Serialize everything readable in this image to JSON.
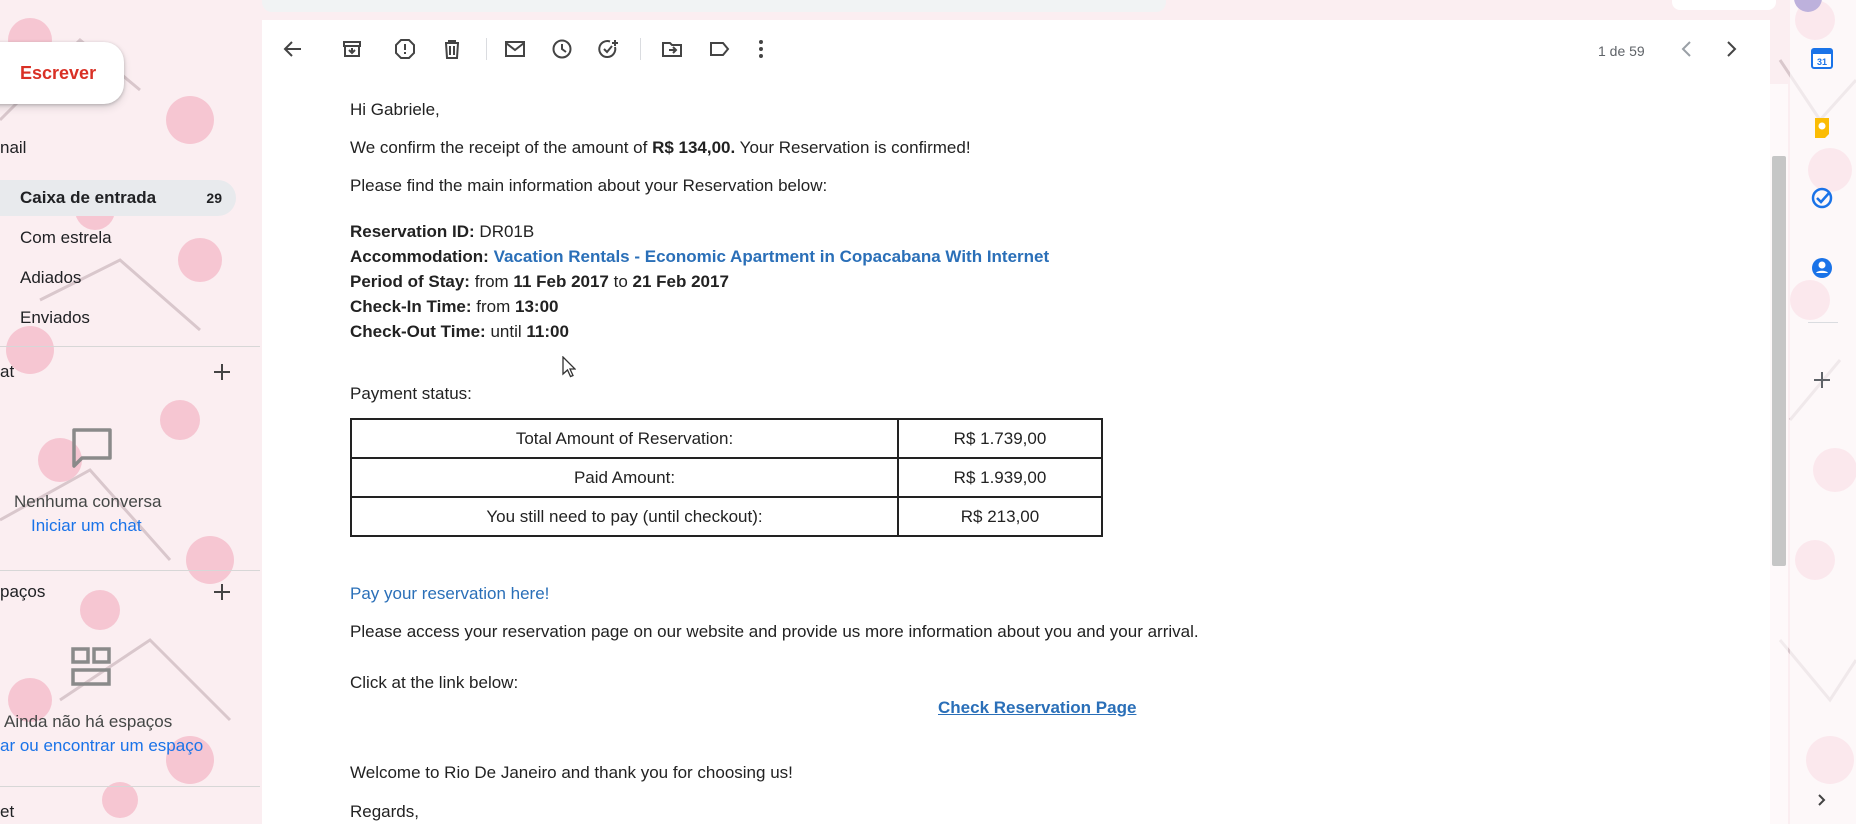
{
  "compose_label": "Escrever",
  "sidebar": {
    "mail_section": "nail",
    "items": [
      {
        "label": "Caixa de entrada",
        "count": "29"
      },
      {
        "label": "Com estrela"
      },
      {
        "label": "Adiados"
      },
      {
        "label": "Enviados"
      }
    ],
    "chat_section": "at",
    "chat_empty": "Nenhuma conversa",
    "chat_link": "Iniciar um chat",
    "spaces_section": "paços",
    "spaces_empty": "Ainda não há espaços",
    "spaces_link": "ar ou encontrar um espaço",
    "meet_section": "et"
  },
  "toolbar": {
    "pager": "1 de 59"
  },
  "email": {
    "greeting": "Hi Gabriele,",
    "confirm_prefix": "We confirm the receipt of the amount of ",
    "confirm_amount": "R$ 134,00.",
    "confirm_suffix": " Your Reservation is confirmed!",
    "intro": "Please find the main information about your Reservation below:",
    "reservation_id_label": "Reservation ID:",
    "reservation_id": " DR01B",
    "accommodation_label": "Accommodation:",
    "accommodation": " Vacation Rentals - Economic Apartment in Copacabana With Internet",
    "period_label": "Period of Stay:",
    "period_from": " from ",
    "period_start": "11 Feb 2017",
    "period_to": " to ",
    "period_end": "21 Feb 2017",
    "checkin_label": "Check-In Time:",
    "checkin_from": " from ",
    "checkin_time": "13:00",
    "checkout_label": "Check-Out Time:",
    "checkout_until": " until ",
    "checkout_time": "11:00",
    "payment_status": "Payment status:",
    "payment_table": [
      {
        "label": "Total Amount of Reservation:",
        "value": "R$ 1.739,00"
      },
      {
        "label": "Paid Amount:",
        "value": "R$ 1.939,00"
      },
      {
        "label": "You still need to pay (until checkout):",
        "value": "R$ 213,00"
      }
    ],
    "pay_link": "Pay your reservation here!",
    "access_text": "Please access your reservation page on our website and provide us more information about you and your arrival.",
    "click_text": "Click at the link below:",
    "check_link": "Check Reservation Page",
    "welcome": "Welcome to Rio De Janeiro and thank you for choosing us!",
    "regards": "Regards,"
  },
  "colors": {
    "compose_text": "#d93025",
    "link": "#2a6fb8",
    "active_nav_bg": "#e8eaed",
    "background": "#fbeef1"
  },
  "icons": {
    "toolbar": [
      "back-arrow-icon",
      "archive-icon",
      "report-spam-icon",
      "delete-icon",
      "mark-unread-icon",
      "snooze-icon",
      "add-task-icon",
      "move-to-icon",
      "label-icon",
      "more-vert-icon",
      "older-chevron-icon",
      "newer-chevron-icon"
    ],
    "right_panel": [
      "calendar-icon",
      "keep-icon",
      "tasks-icon",
      "contacts-icon",
      "add-addon-icon",
      "expand-panel-icon"
    ]
  }
}
